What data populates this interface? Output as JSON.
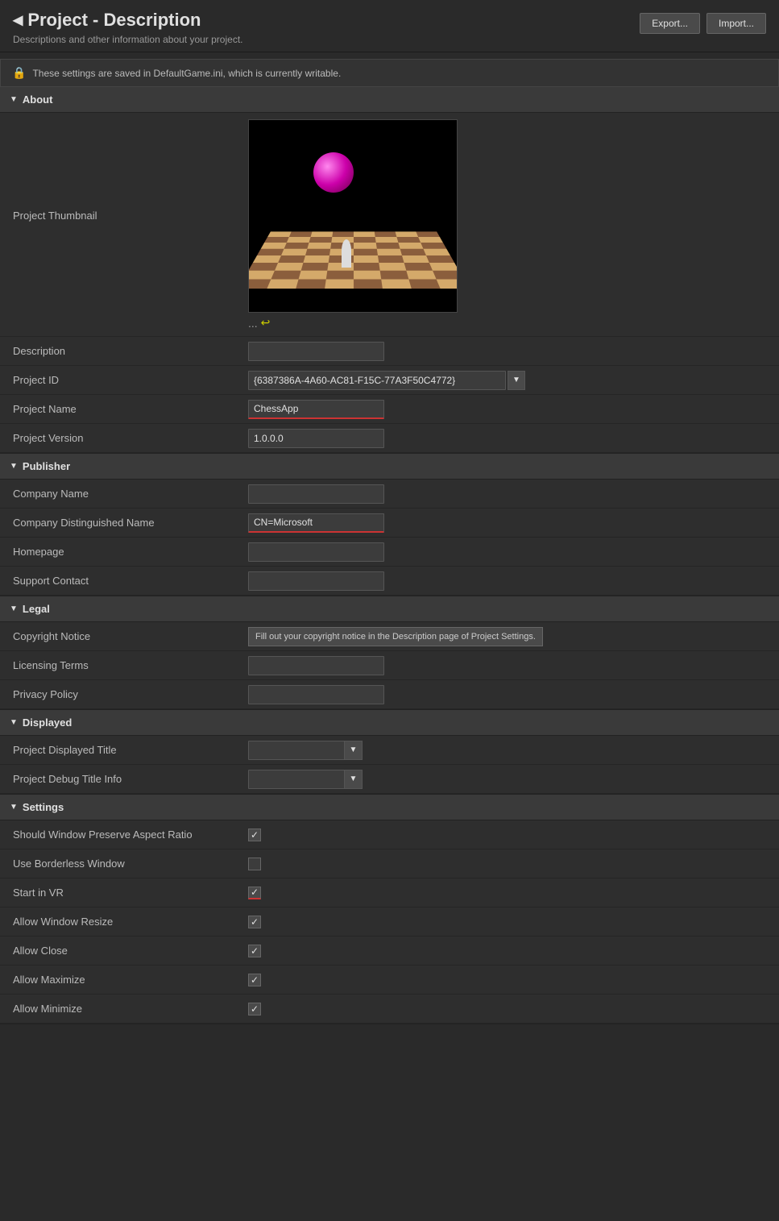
{
  "header": {
    "title": "Project - Description",
    "subtitle": "Descriptions and other information about your project.",
    "export_btn": "Export...",
    "import_btn": "Import...",
    "info_bar": "These settings are saved in DefaultGame.ini, which is currently writable."
  },
  "sections": {
    "about": {
      "label": "About",
      "fields": {
        "thumbnail_label": "Project Thumbnail",
        "description_label": "Description",
        "description_value": "",
        "project_id_label": "Project ID",
        "project_id_value": "{6387386A-4A60-AC81-F15C-77A3F50C4772}",
        "project_name_label": "Project Name",
        "project_name_value": "ChessApp",
        "project_version_label": "Project Version",
        "project_version_value": "1.0.0.0"
      }
    },
    "publisher": {
      "label": "Publisher",
      "fields": {
        "company_name_label": "Company Name",
        "company_name_value": "",
        "company_dn_label": "Company Distinguished Name",
        "company_dn_value": "CN=Microsoft",
        "homepage_label": "Homepage",
        "homepage_value": "",
        "support_label": "Support Contact",
        "support_value": ""
      }
    },
    "legal": {
      "label": "Legal",
      "fields": {
        "copyright_label": "Copyright Notice",
        "copyright_value": "Fill out your copyright notice in the Description page of Project Settings.",
        "licensing_label": "Licensing Terms",
        "licensing_value": "",
        "privacy_label": "Privacy Policy",
        "privacy_value": ""
      }
    },
    "displayed": {
      "label": "Displayed",
      "fields": {
        "title_label": "Project Displayed Title",
        "title_value": "",
        "debug_label": "Project Debug Title Info",
        "debug_value": ""
      }
    },
    "settings": {
      "label": "Settings",
      "fields": {
        "preserve_ratio_label": "Should Window Preserve Aspect Ratio",
        "preserve_ratio_checked": true,
        "borderless_label": "Use Borderless Window",
        "borderless_checked": false,
        "start_vr_label": "Start in VR",
        "start_vr_checked": true,
        "allow_resize_label": "Allow Window Resize",
        "allow_resize_checked": true,
        "allow_close_label": "Allow Close",
        "allow_close_checked": true,
        "allow_maximize_label": "Allow Maximize",
        "allow_maximize_checked": true,
        "allow_minimize_label": "Allow Minimize",
        "allow_minimize_checked": true
      }
    }
  },
  "icons": {
    "arrow_down": "▼",
    "arrow_right": "▶",
    "arrow_collapsed": "▶",
    "lock": "🔒",
    "dots": "...",
    "refresh": "↩"
  }
}
